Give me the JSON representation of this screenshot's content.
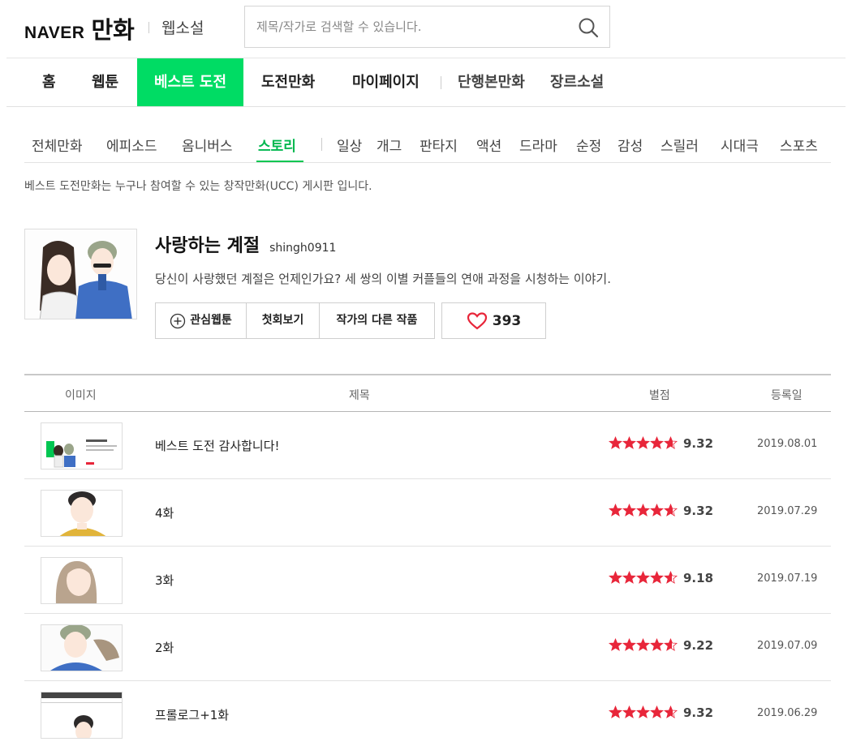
{
  "header": {
    "logo_naver": "NAVER",
    "logo_manhwa": "만화",
    "logo_novel": "웹소설",
    "search_placeholder": "제목/작가로 검색할 수 있습니다."
  },
  "gnb": {
    "items": [
      "홈",
      "웹툰",
      "베스트 도전",
      "도전만화",
      "마이페이지",
      "단행본만화",
      "장르소설"
    ],
    "active": "베스트 도전"
  },
  "genres": {
    "items": [
      "전체만화",
      "에피소드",
      "옴니버스",
      "스토리",
      "일상",
      "개그",
      "판타지",
      "액션",
      "드라마",
      "순정",
      "감성",
      "스릴러",
      "시대극",
      "스포츠"
    ],
    "active": "스토리"
  },
  "notice": "베스트 도전만화는 누구나 참여할 수 있는 창작만화(UCC) 게시판 입니다.",
  "comic": {
    "title": "사랑하는 계절",
    "author": "shingh0911",
    "synopsis": "당신이 사랑했던 계절은 언제인가요? 세 쌍의 이별 커플들의 연애 과정을 시청하는 이야기.",
    "buttons": [
      "관심웹툰",
      "첫회보기",
      "작가의 다른 작품"
    ],
    "likes": "393"
  },
  "table": {
    "headers": [
      "이미지",
      "제목",
      "별점",
      "등록일"
    ],
    "rows": [
      {
        "title": "베스트 도전 감사합니다!",
        "score": "9.32",
        "rating": 9.32,
        "date": "2019.08.01"
      },
      {
        "title": "4화",
        "score": "9.32",
        "rating": 9.32,
        "date": "2019.07.29"
      },
      {
        "title": "3화",
        "score": "9.18",
        "rating": 9.18,
        "date": "2019.07.19"
      },
      {
        "title": "2화",
        "score": "9.22",
        "rating": 9.22,
        "date": "2019.07.09"
      },
      {
        "title": "프롤로그+1화",
        "score": "9.32",
        "rating": 9.32,
        "date": "2019.06.29"
      }
    ]
  },
  "colors": {
    "brand": "#00dc64",
    "active_tab_text": "#00b84f",
    "star": "#e8263a",
    "heart": "#e8263a"
  }
}
